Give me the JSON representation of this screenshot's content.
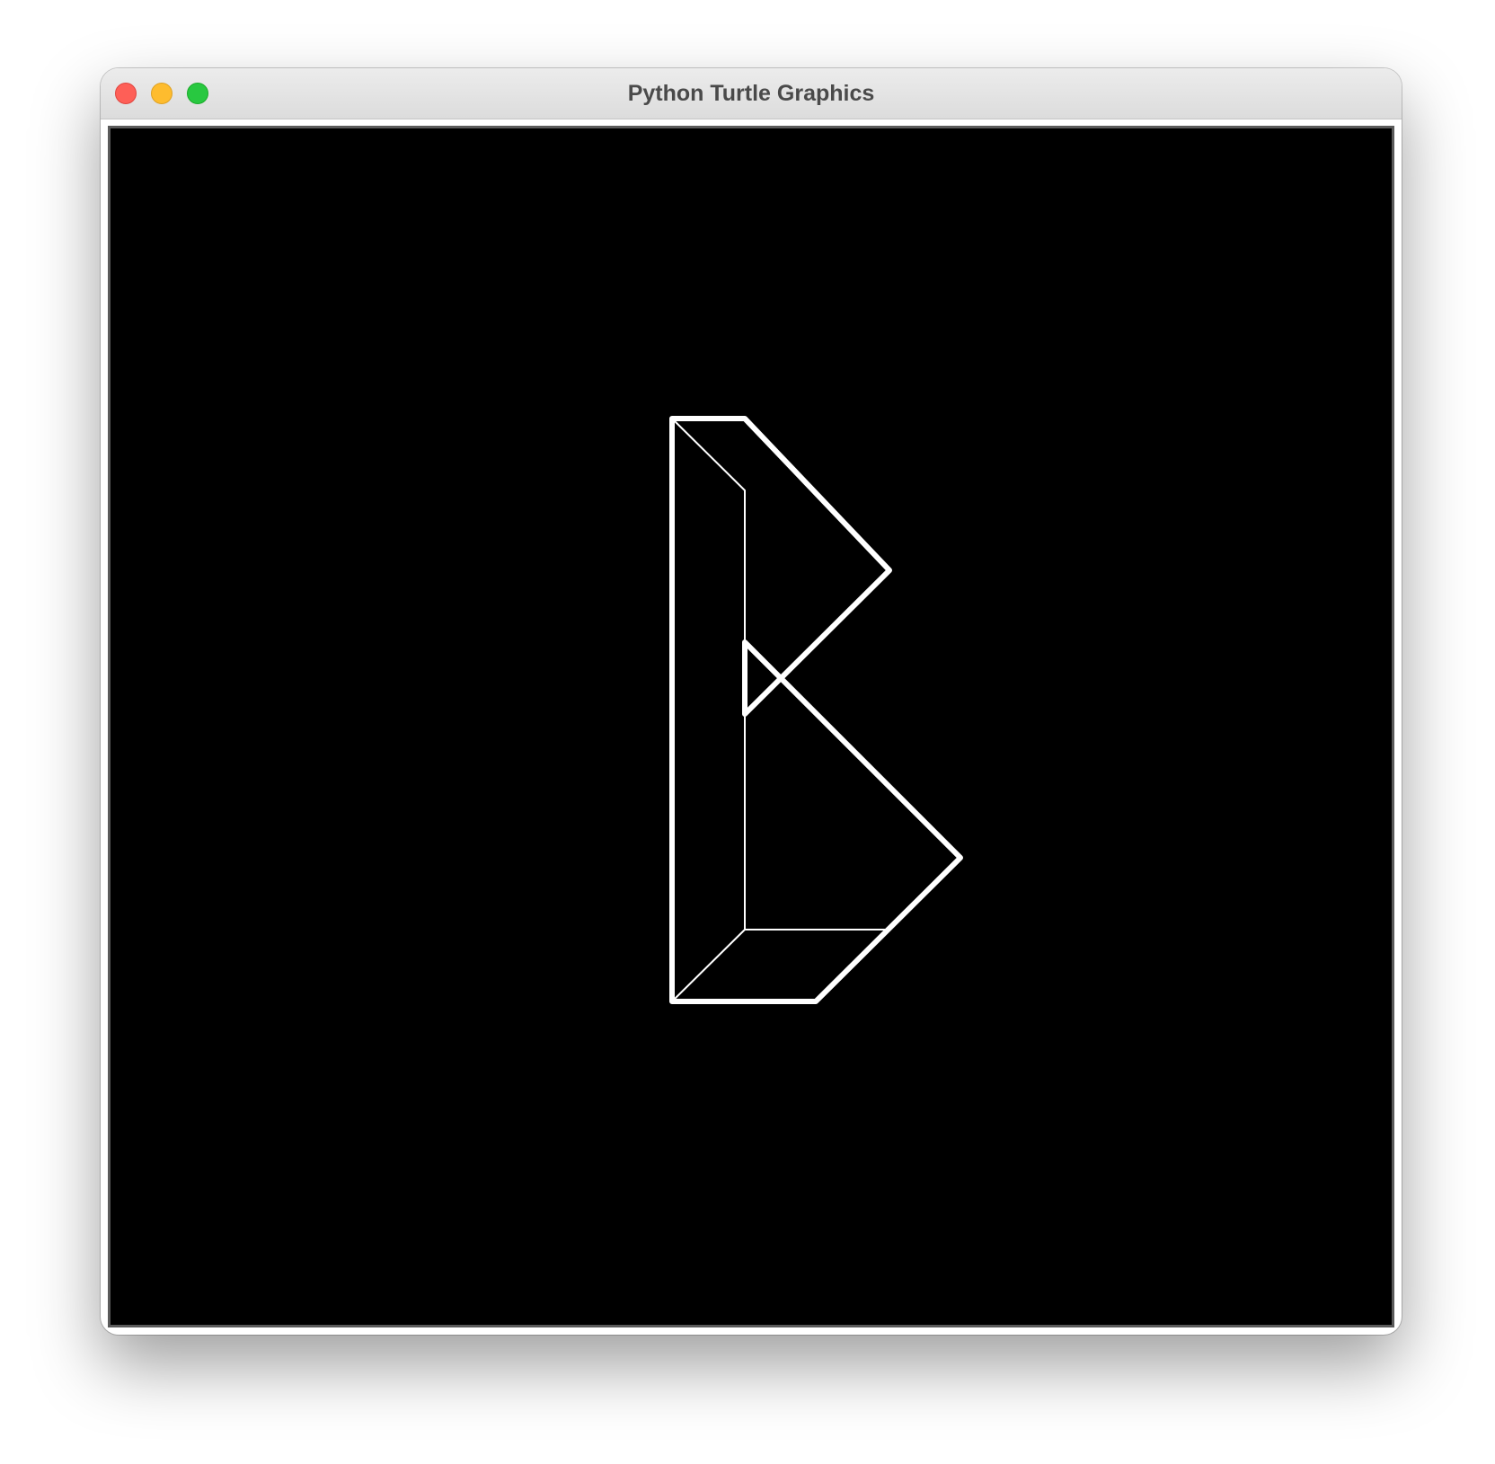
{
  "window": {
    "title": "Python Turtle Graphics"
  },
  "canvas": {
    "background_color": "#000000",
    "stroke_color": "#ffffff"
  },
  "icons": {
    "close": "close-icon",
    "minimize": "minimize-icon",
    "maximize": "maximize-icon"
  }
}
